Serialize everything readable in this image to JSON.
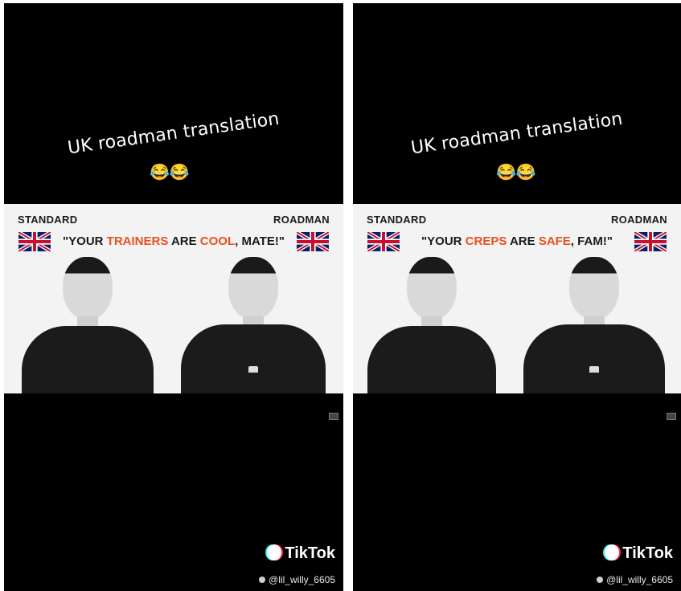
{
  "panels": [
    {
      "caption": "UK roadman translation",
      "emoji": "😂😂",
      "label_left": "STANDARD",
      "label_right": "ROADMAN",
      "quote": {
        "part1": "\"YOUR ",
        "hl1": "TRAINERS",
        "part2": " ARE ",
        "hl2": "COOL",
        "part3": ", MATE!\""
      },
      "watermark": "TikTok",
      "username": "@lil_willy_6605"
    },
    {
      "caption": "UK roadman translation",
      "emoji": "😂😂",
      "label_left": "STANDARD",
      "label_right": "ROADMAN",
      "quote": {
        "part1": "\"YOUR ",
        "hl1": "CREPS",
        "part2": " ARE ",
        "hl2": "SAFE",
        "part3": ", FAM!\""
      },
      "watermark": "TikTok",
      "username": "@lil_willy_6605"
    }
  ],
  "colors": {
    "highlight": "#e8501f",
    "background": "#000000",
    "video_bg": "#f3f3f3"
  },
  "icons": [
    "uk-flag-icon",
    "tiktok-logo-icon",
    "user-icon"
  ]
}
